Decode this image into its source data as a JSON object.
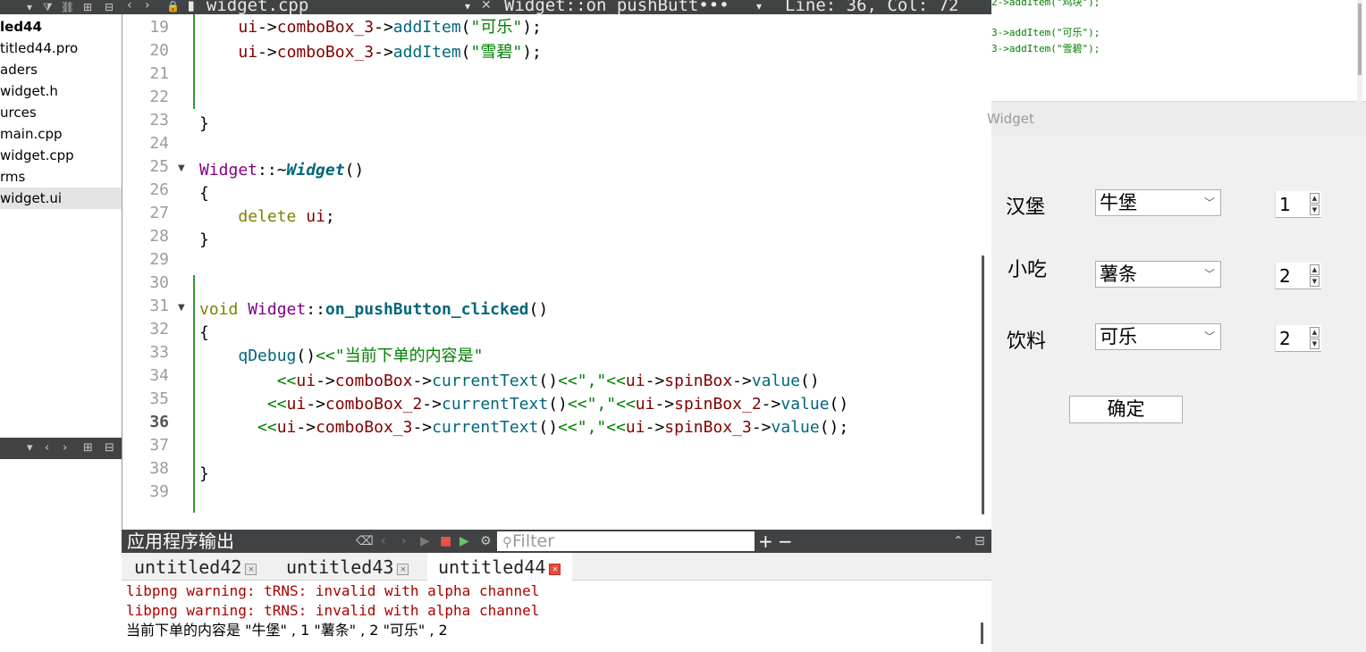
{
  "project": {
    "tree": [
      {
        "label": "led44",
        "bold": true
      },
      {
        "label": "titled44.pro"
      },
      {
        "label": "aders"
      },
      {
        "label": "widget.h"
      },
      {
        "label": "urces"
      },
      {
        "label": "main.cpp"
      },
      {
        "label": "widget.cpp"
      },
      {
        "label": "rms"
      },
      {
        "label": "widget.ui",
        "selected": true
      }
    ]
  },
  "editor": {
    "file_tab": "widget.cpp",
    "function_crumb": "Widget::on_pushButt•••",
    "position": "Line: 36, Col: 72",
    "line_numbers": [
      "19",
      "20",
      "21",
      "22",
      "23",
      "24",
      "25",
      "26",
      "27",
      "28",
      "29",
      "30",
      "31",
      "32",
      "33",
      "34",
      "35",
      "36",
      "37",
      "38",
      "39"
    ],
    "current_line": "36"
  },
  "output": {
    "title": "应用程序输出",
    "filter_placeholder": "Filter",
    "tabs": [
      "untitled42",
      "untitled43",
      "untitled44"
    ],
    "lines": [
      "libpng warning: tRNS: invalid with alpha channel",
      "libpng warning: tRNS: invalid with alpha channel",
      "当前下单的内容是 \"牛堡\" , 1 \"薯条\" , 2 \"可乐\" , 2"
    ]
  },
  "preview": {
    "line1": "2->addItem(\"鸡块\");",
    "line2": "3->addItem(\"可乐\");",
    "line3": "3->addItem(\"雪碧\");"
  },
  "widget": {
    "title": "Widget",
    "rows": [
      {
        "label": "汉堡",
        "combo": "牛堡",
        "spin": "1"
      },
      {
        "label": "小吃",
        "combo": "薯条",
        "spin": "2"
      },
      {
        "label": "饮料",
        "combo": "可乐",
        "spin": "2"
      }
    ],
    "ok_label": "确定"
  }
}
